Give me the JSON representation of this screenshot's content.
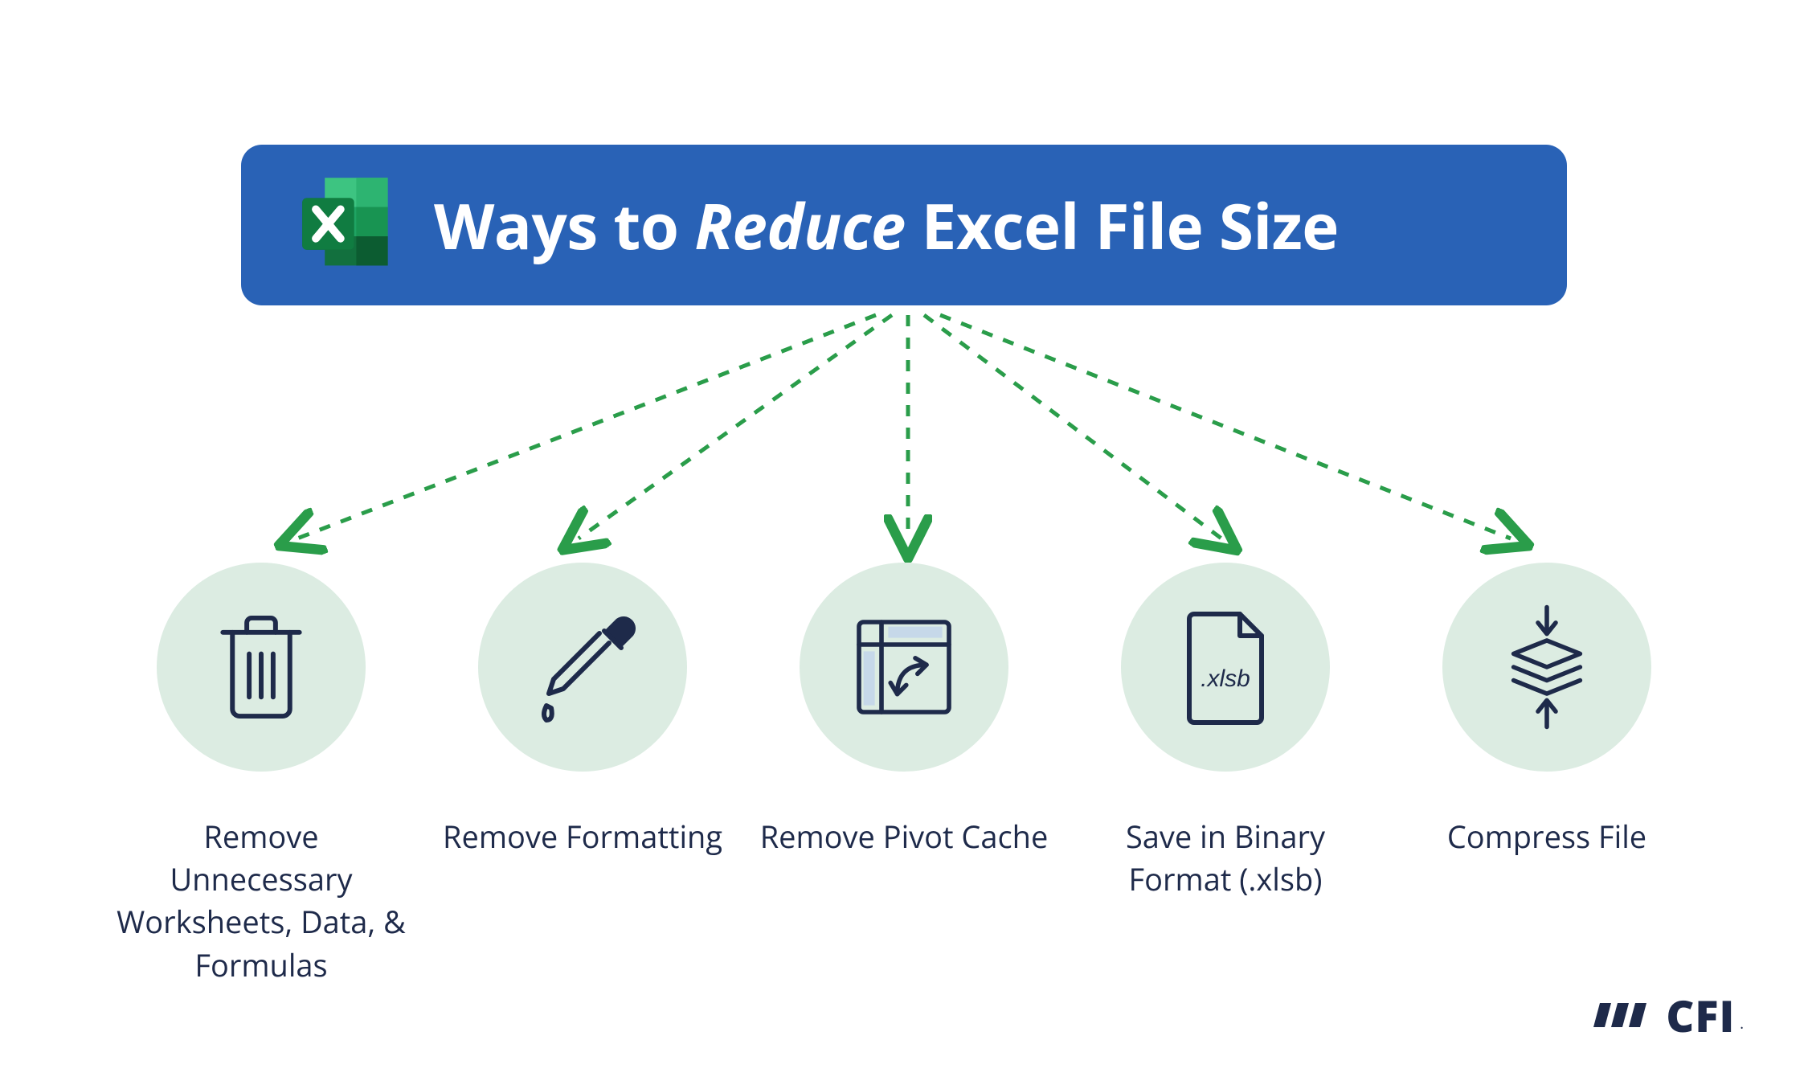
{
  "title": {
    "prefix": "Ways to ",
    "emphasis": "Reduce",
    "suffix": " Excel File Size"
  },
  "methods": [
    {
      "icon": "trash-icon",
      "label": "Remove Unnecessary Worksheets, Data, & Formulas"
    },
    {
      "icon": "eyedropper-icon",
      "label": "Remove Formatting"
    },
    {
      "icon": "pivot-icon",
      "label": "Remove Pivot Cache"
    },
    {
      "icon": "xlsb-file-icon",
      "label": "Save in Binary Format (.xlsb)"
    },
    {
      "icon": "compress-icon",
      "label": "Compress File"
    }
  ],
  "icon_text": {
    "xlsb": ".xlsb"
  },
  "brand": {
    "name": "CFI",
    "tm": "."
  },
  "colors": {
    "title_bg": "#2962b6",
    "circle_bg": "#dcece2",
    "line_stroke": "#1e2a4a",
    "arrow_green": "#2a9d4a"
  }
}
